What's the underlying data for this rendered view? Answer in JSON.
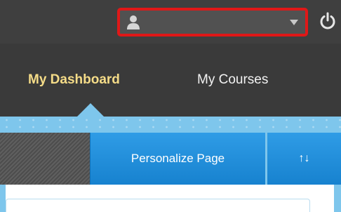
{
  "header": {
    "user_menu": {
      "icon": "user-icon",
      "caret": "chevron-down-icon"
    },
    "logout": {
      "icon": "power-icon"
    }
  },
  "nav": {
    "tabs": [
      {
        "label": "My Dashboard",
        "active": true
      },
      {
        "label": "My Courses",
        "active": false
      }
    ]
  },
  "toolbar": {
    "personalize_label": "Personalize Page",
    "reorder_label": "↑↓"
  },
  "colors": {
    "active_tab": "#f5dc88",
    "accent_blue": "#1f8fda",
    "highlight_border": "#e01818",
    "stripe": "#7ec6ec"
  }
}
